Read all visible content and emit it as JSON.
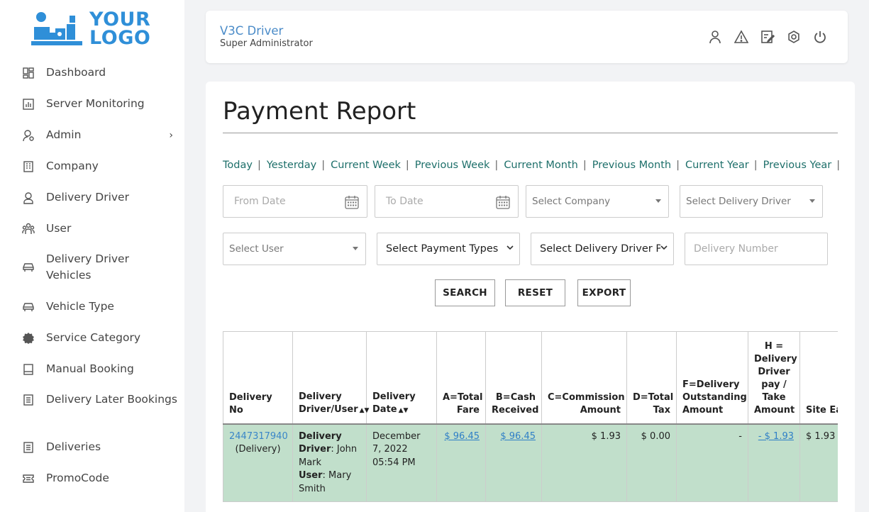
{
  "logo": {
    "line1": "YOUR",
    "line2": "LOGO"
  },
  "sidebar": {
    "items": [
      {
        "label": "Dashboard",
        "icon": "dashboard-icon"
      },
      {
        "label": "Server Monitoring",
        "icon": "chart-icon"
      },
      {
        "label": "Admin",
        "icon": "admin-user-icon",
        "has_chevron": true
      },
      {
        "label": "Company",
        "icon": "building-icon"
      },
      {
        "label": "Delivery Driver",
        "icon": "driver-icon"
      },
      {
        "label": "User",
        "icon": "users-icon"
      },
      {
        "label": "Delivery Driver Vehicles",
        "icon": "car-icon"
      },
      {
        "label": "Vehicle Type",
        "icon": "car-icon"
      },
      {
        "label": "Service Category",
        "icon": "badge-icon"
      },
      {
        "label": "Manual Booking",
        "icon": "book-icon"
      },
      {
        "label": "Delivery Later Bookings",
        "icon": "list-icon"
      },
      {
        "label": "Deliveries",
        "icon": "list-icon"
      },
      {
        "label": "PromoCode",
        "icon": "ticket-icon"
      }
    ],
    "chevron": "›"
  },
  "header": {
    "title": "V3C Driver",
    "subtitle": "Super Administrator",
    "icons": [
      "user-icon",
      "warning-icon",
      "edit-icon",
      "settings-icon",
      "power-icon"
    ]
  },
  "main": {
    "title": "Payment Report",
    "quick_filters": [
      "Today",
      "Yesterday",
      "Current Week",
      "Previous Week",
      "Current Month",
      "Previous Month",
      "Current Year",
      "Previous Year"
    ],
    "separator": "|",
    "filters": {
      "from_date": "From Date",
      "to_date": "To Date",
      "company": "Select Company",
      "driver": "Select Delivery Driver",
      "user": "Select User",
      "payment_types": "Select Payment Types",
      "driver_pay": "Select Delivery Driver Pay",
      "delivery_number": "Delivery Number"
    },
    "buttons": {
      "search": "SEARCH",
      "reset": "RESET",
      "export": "EXPORT"
    }
  },
  "table": {
    "headers": {
      "delivery_no": "Delivery No",
      "driver_user": "Delivery Driver/User",
      "date": "Delivery Date",
      "total_fare": "A=Total Fare",
      "cash": "B=Cash Received",
      "commission": "C=Commission Amount",
      "tax": "D=Total Tax",
      "outstanding": "F=Delivery Outstanding Amount",
      "driver_pay": "H = Delivery Driver pay / Take Amount",
      "site_earning": "Site Earning"
    },
    "sort_glyph": "▲▼",
    "rows": [
      {
        "delivery_no": "2447317940",
        "delivery_type": "(Delivery)",
        "driver_label": "Delivery Driver",
        "driver_name": ": John Mark",
        "user_label": "User",
        "user_name": ": Mary Smith",
        "date": "December 7, 2022 05:54 PM",
        "total_fare": "$ 96.45",
        "cash": "$ 96.45",
        "commission": "$ 1.93",
        "tax": "$ 0.00",
        "outstanding": "-",
        "driver_pay": "- $ 1.93",
        "site_earning": "$ 1.93"
      }
    ]
  }
}
